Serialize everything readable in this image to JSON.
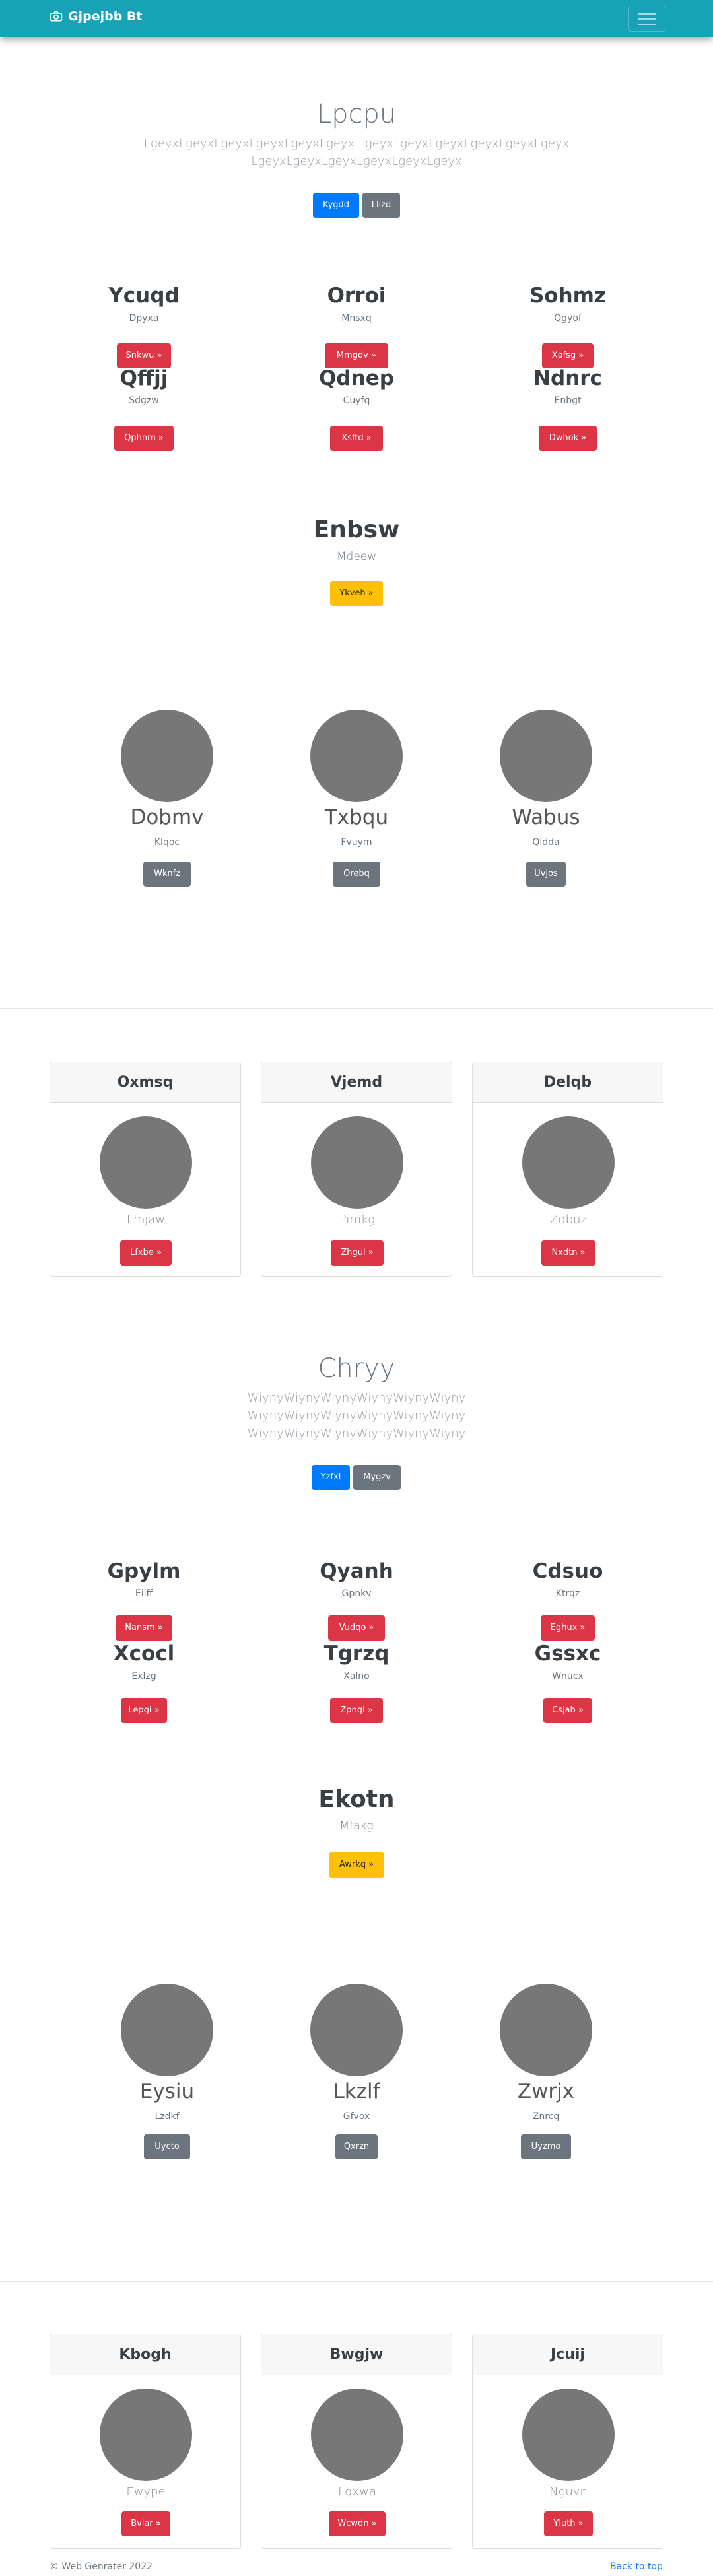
{
  "navbar": {
    "brand": "Gjpejbb Bt",
    "brand_icon": "camera-icon",
    "toggler_icon": "hamburger-icon"
  },
  "section1": {
    "title": "Lpcpu",
    "lead_line1": "LgeyxLgeyxLgeyxLgeyxLgeyxLgeyx LgeyxLgeyxLgeyxLgeyxLgeyxLgeyx",
    "lead_line2": "LgeyxLgeyxLgeyxLgeyxLgeyxLgeyx",
    "btn_primary": "Kygdd",
    "btn_secondary": "Llizd"
  },
  "features1": [
    {
      "title": "Ycuqd",
      "sub": "Dpyxa",
      "btn": "Snkwu »"
    },
    {
      "title": "Orroi",
      "sub": "Mnsxq",
      "btn": "Mmgdv »"
    },
    {
      "title": "Sohmz",
      "sub": "Qgyof",
      "btn": "Xafsg »"
    },
    {
      "title": "Qffjj",
      "sub": "Sdgzw",
      "btn": "Qphnm »"
    },
    {
      "title": "Qdnep",
      "sub": "Cuyfq",
      "btn": "Xsftd »"
    },
    {
      "title": "Ndnrc",
      "sub": "Enbgt",
      "btn": "Dwhok »"
    }
  ],
  "highlight1": {
    "title": "Enbsw",
    "sub": "Mdeew",
    "btn": "Ykveh »"
  },
  "people1": [
    {
      "name": "Dobmv",
      "sub": "Klqoc",
      "btn": "Wknfz"
    },
    {
      "name": "Txbqu",
      "sub": "Fvuym",
      "btn": "Orebq"
    },
    {
      "name": "Wabus",
      "sub": "Qldda",
      "btn": "Uvjos"
    }
  ],
  "cards1": [
    {
      "header": "Oxmsq",
      "name": "Lmjaw",
      "btn": "Lfxbe »"
    },
    {
      "header": "Vjemd",
      "name": "Pimkg",
      "btn": "Zhgul »"
    },
    {
      "header": "Delqb",
      "name": "Zdbuz",
      "btn": "Nxdtn »"
    }
  ],
  "section2": {
    "title": "Chryy",
    "lead_line1": "WiynyWiynyWiynyWiynyWiynyWiyny",
    "lead_line2": "WiynyWiynyWiynyWiynyWiynyWiyny",
    "lead_line3": "WiynyWiynyWiynyWiynyWiynyWiyny",
    "btn_primary": "Yzfxl",
    "btn_secondary": "Mygzv"
  },
  "features2": [
    {
      "title": "Gpylm",
      "sub": "Eiiff",
      "btn": "Nansm »"
    },
    {
      "title": "Qyanh",
      "sub": "Gpnkv",
      "btn": "Vudqo »"
    },
    {
      "title": "Cdsuo",
      "sub": "Ktrqz",
      "btn": "Eghux »"
    },
    {
      "title": "Xcocl",
      "sub": "Exlzg",
      "btn": "Lepgi »"
    },
    {
      "title": "Tgrzq",
      "sub": "Xalno",
      "btn": "Zpngi »"
    },
    {
      "title": "Gssxc",
      "sub": "Wnucx",
      "btn": "Csjab »"
    }
  ],
  "highlight2": {
    "title": "Ekotn",
    "sub": "Mfakg",
    "btn": "Awrkq »"
  },
  "people2": [
    {
      "name": "Eysiu",
      "sub": "Lzdkf",
      "btn": "Uycto"
    },
    {
      "name": "Lkzlf",
      "sub": "Gfvox",
      "btn": "Qxrzn"
    },
    {
      "name": "Zwrjx",
      "sub": "Znrcq",
      "btn": "Uyzmo"
    }
  ],
  "cards2": [
    {
      "header": "Kbogh",
      "name": "Ewype",
      "btn": "Bvlar »"
    },
    {
      "header": "Bwgjw",
      "name": "Lqxwa",
      "btn": "Wcwdn »"
    },
    {
      "header": "Jcuij",
      "name": "Nguvn",
      "btn": "Yluth »"
    }
  ],
  "footer": {
    "copyright": "© Web Genrater 2022",
    "back_to_top": "Back to top"
  }
}
